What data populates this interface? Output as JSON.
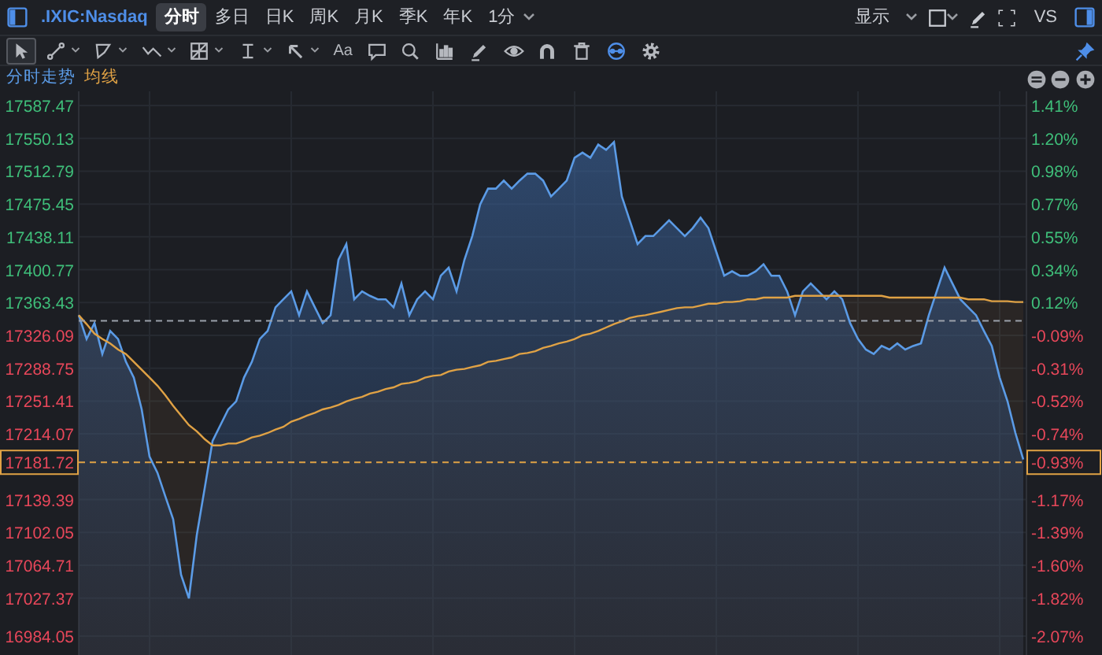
{
  "toolbar": {
    "symbol": ".IXIC:Nasdaq",
    "tabs": [
      {
        "label": "分时",
        "selected": true
      },
      {
        "label": "多日",
        "selected": false
      },
      {
        "label": "日K",
        "selected": false
      },
      {
        "label": "周K",
        "selected": false
      },
      {
        "label": "月K",
        "selected": false
      },
      {
        "label": "季K",
        "selected": false
      },
      {
        "label": "年K",
        "selected": false
      },
      {
        "label": "1分",
        "selected": false
      }
    ],
    "display_menu": {
      "label": "显示"
    },
    "checkbox": {
      "checked": false
    },
    "vs_button": {
      "label": "VS"
    }
  },
  "drawing_tools": [
    {
      "kind": "cursor",
      "selected": true,
      "active": false
    },
    {
      "kind": "segment",
      "selected": false,
      "active": false
    },
    {
      "kind": "polygon",
      "selected": false,
      "active": false
    },
    {
      "kind": "wave",
      "selected": false,
      "active": false
    },
    {
      "kind": "grid",
      "selected": false,
      "active": false
    },
    {
      "kind": "measure",
      "selected": false,
      "active": false
    },
    {
      "kind": "arrow",
      "selected": false,
      "active": false
    },
    {
      "kind": "text",
      "label": "Aa",
      "selected": false,
      "active": false
    },
    {
      "kind": "comment",
      "selected": false,
      "active": false
    },
    {
      "kind": "search",
      "selected": false,
      "active": false
    },
    {
      "kind": "bars",
      "selected": false,
      "active": false
    },
    {
      "kind": "pen",
      "selected": false,
      "active": false
    },
    {
      "kind": "eye",
      "selected": false,
      "active": false
    },
    {
      "kind": "magnet",
      "selected": false,
      "active": false
    },
    {
      "kind": "trash",
      "selected": false,
      "active": false
    },
    {
      "kind": "ring",
      "selected": false,
      "active": true
    },
    {
      "kind": "gear",
      "selected": false,
      "active": false
    }
  ],
  "percent_axis": {
    "labels": [
      "1.41%",
      "1.20%",
      "0.98%",
      "0.77%",
      "0.55%",
      "0.34%",
      "0.12%",
      "-0.09%",
      "-0.31%",
      "-0.52%",
      "-0.74%",
      "-1.17%",
      "-1.39%",
      "-1.60%",
      "-1.82%",
      "-2.07%"
    ],
    "last_price_label": "-0.93%"
  },
  "chart_data": {
    "type": "area",
    "stacked": false,
    "grid": true,
    "ylim": [
      16962.6,
      17603.6
    ],
    "yticks": [
      {
        "value": 17587.47,
        "label": "17587.47"
      },
      {
        "value": 17550.13,
        "label": "17550.13"
      },
      {
        "value": 17512.79,
        "label": "17512.79"
      },
      {
        "value": 17475.45,
        "label": "17475.45"
      },
      {
        "value": 17438.11,
        "label": "17438.11"
      },
      {
        "value": 17400.77,
        "label": "17400.77"
      },
      {
        "value": 17363.43,
        "label": "17363.43"
      },
      {
        "value": 17326.09,
        "label": "17326.09"
      },
      {
        "value": 17288.75,
        "label": "17288.75"
      },
      {
        "value": 17251.41,
        "label": "17251.41"
      },
      {
        "value": 17214.07,
        "label": "17214.07"
      },
      {
        "value": 17139.39,
        "label": "17139.39"
      },
      {
        "value": 17102.05,
        "label": "17102.05"
      },
      {
        "value": 17064.71,
        "label": "17064.71"
      },
      {
        "value": 17027.37,
        "label": "17027.37"
      },
      {
        "value": 16984.05,
        "label": "16984.05"
      }
    ],
    "series": [
      {
        "name": "分时走势",
        "color": "#5b9be6",
        "values": [
          17349,
          17322,
          17340,
          17305,
          17331,
          17322,
          17296,
          17278,
          17242,
          17188,
          17170,
          17143,
          17117,
          17054,
          17027,
          17099,
          17152,
          17206,
          17224,
          17242,
          17251,
          17278,
          17296,
          17322,
          17331,
          17358,
          17367,
          17376,
          17349,
          17376,
          17358,
          17340,
          17349,
          17412,
          17430,
          17367,
          17376,
          17371,
          17367,
          17367,
          17358,
          17385,
          17349,
          17367,
          17376,
          17367,
          17394,
          17403,
          17376,
          17412,
          17439,
          17475,
          17493,
          17493,
          17502,
          17493,
          17502,
          17510,
          17510,
          17502,
          17484,
          17493,
          17502,
          17528,
          17534,
          17528,
          17543,
          17537,
          17546,
          17484,
          17457,
          17430,
          17439,
          17439,
          17448,
          17457,
          17448,
          17439,
          17448,
          17460,
          17448,
          17421,
          17394,
          17399,
          17394,
          17394,
          17399,
          17407,
          17394,
          17394,
          17376,
          17349,
          17376,
          17385,
          17376,
          17367,
          17376,
          17367,
          17340,
          17322,
          17310,
          17305,
          17314,
          17310,
          17317,
          17310,
          17314,
          17317,
          17349,
          17376,
          17403,
          17385,
          17367,
          17358,
          17349,
          17331,
          17314,
          17278,
          17251,
          17215,
          17185
        ]
      },
      {
        "name": "均线",
        "color": "#e0a245",
        "values": [
          17349,
          17339,
          17328,
          17322,
          17317,
          17310,
          17305,
          17296,
          17287,
          17278,
          17269,
          17258,
          17246,
          17235,
          17224,
          17217,
          17208,
          17201,
          17201,
          17203,
          17203,
          17206,
          17210,
          17212,
          17215,
          17219,
          17222,
          17228,
          17231,
          17235,
          17238,
          17242,
          17244,
          17247,
          17251,
          17254,
          17256,
          17260,
          17262,
          17265,
          17267,
          17271,
          17272,
          17274,
          17278,
          17280,
          17281,
          17285,
          17287,
          17288,
          17290,
          17292,
          17296,
          17297,
          17299,
          17301,
          17305,
          17306,
          17308,
          17312,
          17314,
          17317,
          17319,
          17322,
          17326,
          17328,
          17331,
          17335,
          17339,
          17342,
          17346,
          17348,
          17349,
          17351,
          17353,
          17355,
          17357,
          17358,
          17358,
          17360,
          17362,
          17362,
          17364,
          17364,
          17365,
          17367,
          17367,
          17369,
          17369,
          17369,
          17369,
          17371,
          17371,
          17371,
          17371,
          17371,
          17371,
          17371,
          17371,
          17371,
          17371,
          17371,
          17371,
          17369,
          17369,
          17369,
          17369,
          17369,
          17369,
          17369,
          17369,
          17369,
          17369,
          17367,
          17367,
          17367,
          17365,
          17365,
          17365,
          17364,
          17364
        ]
      }
    ],
    "ref_lines": [
      {
        "axis": "y",
        "value": 17342.6,
        "color": "#9aa0aa"
      },
      {
        "axis": "y",
        "value": 17181.72,
        "color": "#e0a245",
        "label": "17181.72"
      }
    ]
  }
}
